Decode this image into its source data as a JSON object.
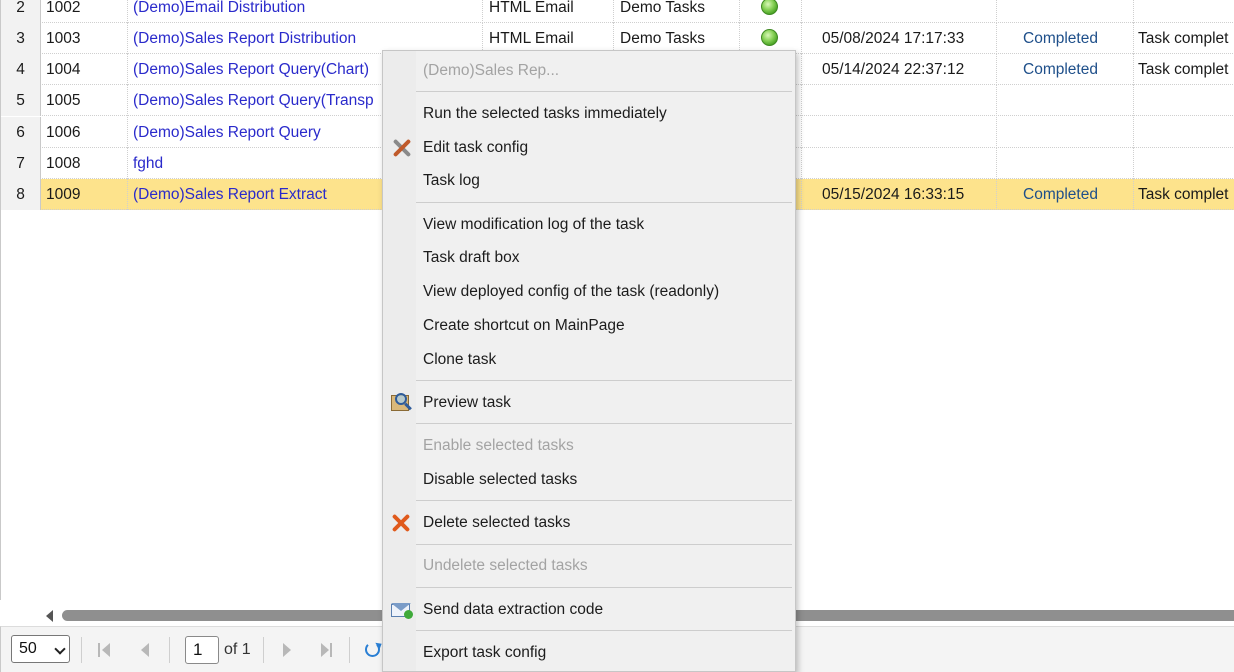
{
  "grid": {
    "rows": [
      {
        "rownum": "2",
        "id": "1002",
        "name": "(Demo)Email Distribution",
        "type": "HTML Email",
        "group": "Demo Tasks",
        "status_icon": "green-dot-icon",
        "time": "",
        "result": "",
        "message": ""
      },
      {
        "rownum": "3",
        "id": "1003",
        "name": "(Demo)Sales Report Distribution",
        "type": "HTML Email",
        "group": "Demo Tasks",
        "status_icon": "green-dot-icon",
        "time": "05/08/2024 17:17:33",
        "result": "Completed",
        "message": "Task complet"
      },
      {
        "rownum": "4",
        "id": "1004",
        "name": "(Demo)Sales Report Query(Chart)",
        "type": "",
        "group": "",
        "status_icon": "",
        "time": "05/14/2024 22:37:12",
        "result": "Completed",
        "message": "Task complet"
      },
      {
        "rownum": "5",
        "id": "1005",
        "name": "(Demo)Sales Report Query(Transp",
        "type": "",
        "group": "",
        "status_icon": "",
        "time": "",
        "result": "",
        "message": ""
      },
      {
        "rownum": "6",
        "id": "1006",
        "name": "(Demo)Sales Report Query",
        "type": "",
        "group": "",
        "status_icon": "",
        "time": "",
        "result": "",
        "message": ""
      },
      {
        "rownum": "7",
        "id": "1008",
        "name": "fghd",
        "type": "",
        "group": "",
        "status_icon": "",
        "time": "",
        "result": "",
        "message": ""
      },
      {
        "rownum": "8",
        "id": "1009",
        "name": "(Demo)Sales Report Extract",
        "type": "",
        "group": "",
        "status_icon": "",
        "time": "05/15/2024 16:33:15",
        "result": "Completed",
        "message": "Task complet",
        "selected": true
      }
    ]
  },
  "context_menu": {
    "title": "(Demo)Sales Rep...",
    "items": [
      {
        "label": "Run the selected tasks immediately",
        "icon": "",
        "disabled": false
      },
      {
        "label": "Edit task config",
        "icon": "tools-icon",
        "disabled": false
      },
      {
        "label": "Task log",
        "icon": "",
        "disabled": false
      },
      {
        "label": "View modification log of the task",
        "icon": "",
        "disabled": false
      },
      {
        "label": "Task draft box",
        "icon": "",
        "disabled": false
      },
      {
        "label": "View deployed config of the task (readonly)",
        "icon": "",
        "disabled": false
      },
      {
        "label": "Create shortcut on MainPage",
        "icon": "",
        "disabled": false
      },
      {
        "label": "Clone task",
        "icon": "",
        "disabled": false
      },
      {
        "label": "Preview task",
        "icon": "preview-icon",
        "disabled": false
      },
      {
        "label": "Enable selected tasks",
        "icon": "",
        "disabled": true
      },
      {
        "label": "Disable selected tasks",
        "icon": "",
        "disabled": false
      },
      {
        "label": "Delete selected tasks",
        "icon": "delete-icon",
        "disabled": false
      },
      {
        "label": "Undelete selected tasks",
        "icon": "",
        "disabled": true
      },
      {
        "label": "Send data extraction code",
        "icon": "mail-send-icon",
        "disabled": false
      },
      {
        "label": "Export task config",
        "icon": "",
        "disabled": false
      }
    ]
  },
  "pager": {
    "page_size": "50",
    "current_page": "1",
    "of_label": "of 1"
  },
  "colors": {
    "selected_row": "#fde38c",
    "link_text": "#2a2acb",
    "completed_text": "#1e4f8a",
    "disabled_text": "#a3a3a3"
  }
}
